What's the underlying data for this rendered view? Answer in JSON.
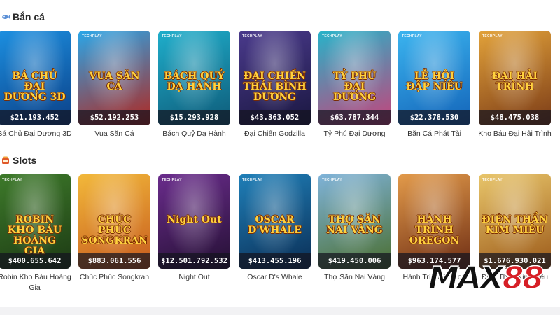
{
  "sections": [
    {
      "title": "Bắn cá",
      "icon": "fish-icon",
      "games": [
        {
          "name": "Bá Chủ Đại Dương 3D",
          "jackpot": "$21.193.452",
          "art": "BÁ CHỦ ĐẠI DƯƠNG 3D",
          "colors": [
            "#1c8fe0",
            "#0b3f86"
          ]
        },
        {
          "name": "Vua Săn Cá",
          "jackpot": "$52.192.253",
          "art": "VUA SĂN CÁ",
          "colors": [
            "#2aa6e8",
            "#b3261e"
          ]
        },
        {
          "name": "Bách Quỷ Dạ Hành",
          "jackpot": "$15.293.928",
          "art": "BÁCH QUỶ DẠ HÀNH",
          "colors": [
            "#1faecb",
            "#0e5a78"
          ]
        },
        {
          "name": "Đại Chiến Godzilla",
          "jackpot": "$43.363.052",
          "art": "ĐẠI CHIẾN THÁI BÌNH DƯƠNG",
          "colors": [
            "#4a3a8c",
            "#1a1740"
          ]
        },
        {
          "name": "Tỷ Phú Đại Dương",
          "jackpot": "$63.787.344",
          "art": "TỶ PHÚ ĐẠI DƯƠNG",
          "colors": [
            "#27b3c9",
            "#c7427a"
          ]
        },
        {
          "name": "Bắn Cá Phát Tài",
          "jackpot": "$22.378.530",
          "art": "LỄ HỘI ĐẬP NIÊU",
          "colors": [
            "#3bb4ef",
            "#1363b8"
          ]
        },
        {
          "name": "Kho Báu Đại Hải Trình",
          "jackpot": "$48.475.038",
          "art": "ĐẠI HẢI TRÌNH",
          "colors": [
            "#e2a23a",
            "#7b3b17"
          ]
        }
      ]
    },
    {
      "title": "Slots",
      "icon": "slot-machine-icon",
      "games": [
        {
          "name": "Robin Kho Báu Hoàng Gia",
          "jackpot": "$400.655.642",
          "art": "ROBIN KHO BÁU HOÀNG GIA",
          "colors": [
            "#3d7a2a",
            "#1d3a14"
          ]
        },
        {
          "name": "Chúc Phúc Songkran",
          "jackpot": "$883.061.556",
          "art": "CHÚC PHÚC SONGKRAN",
          "colors": [
            "#f2b83a",
            "#c65a1e"
          ]
        },
        {
          "name": "Night Out",
          "jackpot": "$12.501.792.532",
          "art": "Night Out",
          "colors": [
            "#6a2c8c",
            "#241033"
          ]
        },
        {
          "name": "Oscar D's Whale",
          "jackpot": "$413.455.196",
          "art": "OSCAR D'WHALE",
          "colors": [
            "#1f7fb8",
            "#0b2e55"
          ]
        },
        {
          "name": "Thợ Săn Nai Vàng",
          "jackpot": "$419.450.006",
          "art": "THỢ SĂN NAI VÀNG",
          "colors": [
            "#7fb3d9",
            "#4a6e2f"
          ]
        },
        {
          "name": "Hành Trình Oregon",
          "jackpot": "$963.174.577",
          "art": "HÀNH TRÌNH OREGON",
          "colors": [
            "#e29a4a",
            "#6e2d14"
          ]
        },
        {
          "name": "Điện Thần Kim Miêu",
          "jackpot": "$1.676.930.021",
          "art": "ĐIỆN THẦN KIM MIÊU",
          "colors": [
            "#e8c56a",
            "#9c5a1a"
          ]
        }
      ]
    }
  ],
  "brand_small": "TECHPLAY",
  "logo": {
    "text_a": "MAX",
    "text_b": "88"
  }
}
